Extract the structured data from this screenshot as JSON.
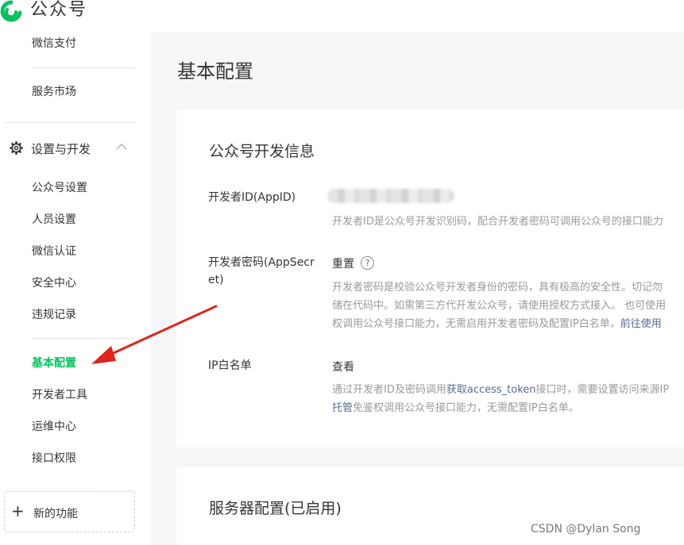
{
  "header": {
    "logo_text": "公众号"
  },
  "sidebar": {
    "items_top": [
      {
        "label": "微信支付"
      },
      {
        "label": "服务市场"
      }
    ],
    "section": {
      "label": "设置与开发"
    },
    "sub_items": [
      {
        "label": "公众号设置"
      },
      {
        "label": "人员设置"
      },
      {
        "label": "微信认证"
      },
      {
        "label": "安全中心"
      },
      {
        "label": "违规记录"
      },
      {
        "label": "基本配置"
      },
      {
        "label": "开发者工具"
      },
      {
        "label": "运维中心"
      },
      {
        "label": "接口权限"
      }
    ],
    "new_feature": {
      "label": "新的功能"
    }
  },
  "main": {
    "title": "基本配置",
    "dev_info": {
      "title": "公众号开发信息",
      "appid": {
        "label": "开发者ID(AppID)",
        "desc": "开发者ID是公众号开发识别码，配合开发者密码可调用公众号的接口能力"
      },
      "secret": {
        "label": "开发者密码(AppSecret)",
        "action": "重置",
        "help": "?",
        "desc_line1": "开发者密码是校验公众号开发者身份的密码，具有极高的安全性。切记勿",
        "desc_line2": "储在代码中。如需第三方代开发公众号，请使用授权方式接入。 也可使用",
        "desc_line3_pre": "权调用公众号接口能力，无需启用开发者密码及配置IP白名单，",
        "desc_line3_link": "前往使用"
      },
      "ip": {
        "label": "IP白名单",
        "action": "查看",
        "desc_line1_pre": "通过开发者ID及密码调用",
        "desc_line1_link": "获取access_token",
        "desc_line1_post": "接口时，需要设置访问来源IP",
        "desc_line2_link": "托管",
        "desc_line2_post": "免鉴权调用公众号接口能力，无需配置IP白名单。"
      }
    },
    "server": {
      "title": "服务器配置(已启用)"
    }
  },
  "watermark": "CSDN @Dylan  Song",
  "colors": {
    "accent": "#07c160",
    "link": "#576b95",
    "arrow": "#e0231b"
  }
}
